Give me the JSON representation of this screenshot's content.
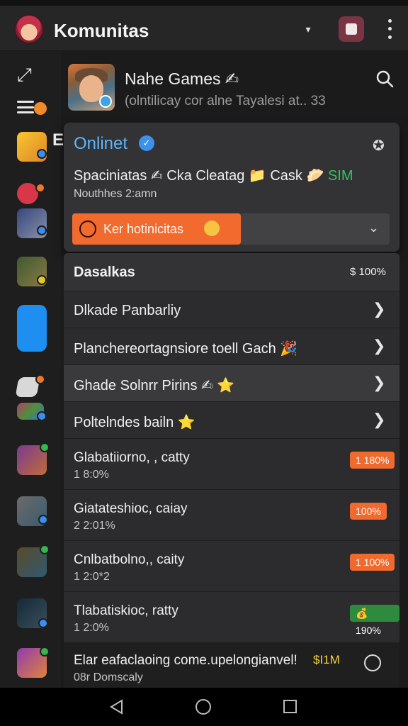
{
  "appbar": {
    "title": "Komunitas",
    "colors": {
      "bar": "#262627",
      "badge": "#7a3443"
    },
    "icons": [
      "avatar-icon",
      "chevron-down-icon",
      "community-badge-icon",
      "more-vertical-icon"
    ]
  },
  "sidebar": {
    "letter": "E",
    "icons": [
      "expand-icon",
      "menu-icon",
      "game-app-icon"
    ]
  },
  "header": {
    "title": "Nahe Games ✍",
    "subtitle": "(olntilicay cor alne Tayalesi at..   33"
  },
  "card": {
    "title": "Onlinet",
    "line1_prefix": "Spaciniatas ✍ Cka Cleatag 📁 Cask 🥟 ",
    "line1_highlight": "SIM",
    "line2": "Nouthhes 2:amn",
    "dropdown_label": "Ker hotinicitas",
    "accent": "#f26a2d",
    "verified_color": "#3a92ea"
  },
  "list": {
    "header_title": "Dasalkas",
    "header_value": "$ 100%",
    "items": [
      {
        "label": "Dlkade Panbarliy"
      },
      {
        "label": "Planchereortagnsiore toell Gach 🎉"
      },
      {
        "label": "Ghade Solnrr Pirins ✍ ⭐"
      },
      {
        "label": "Poltelndes bailn ⭐"
      }
    ],
    "stats": [
      {
        "label": "Glabatiiorno, , catty",
        "sub": "1 8:0%",
        "badge": "1 180%",
        "badge_color": "#f06a2e"
      },
      {
        "label": "Giatateshioc, caiay",
        "sub": "2 2:01%",
        "badge": "100%",
        "badge_color": "#f06a2e"
      },
      {
        "label": "Cnlbatbolno,, caity",
        "sub": "1 2:0*2",
        "badge": "1 100%",
        "badge_color": "#f06a2e"
      },
      {
        "label": "Tlabatiskioc, ratty",
        "sub": "1 2:0%",
        "badge": "💰 190%",
        "badge_color": "#2e8b3e"
      }
    ],
    "last": {
      "label": "Elar eafaclaoing come.upelongianvel!",
      "tag": "$I1M",
      "sub": "08r Domscaly"
    }
  },
  "nav": {
    "icons": [
      "back-icon",
      "home-icon",
      "recents-icon"
    ]
  }
}
